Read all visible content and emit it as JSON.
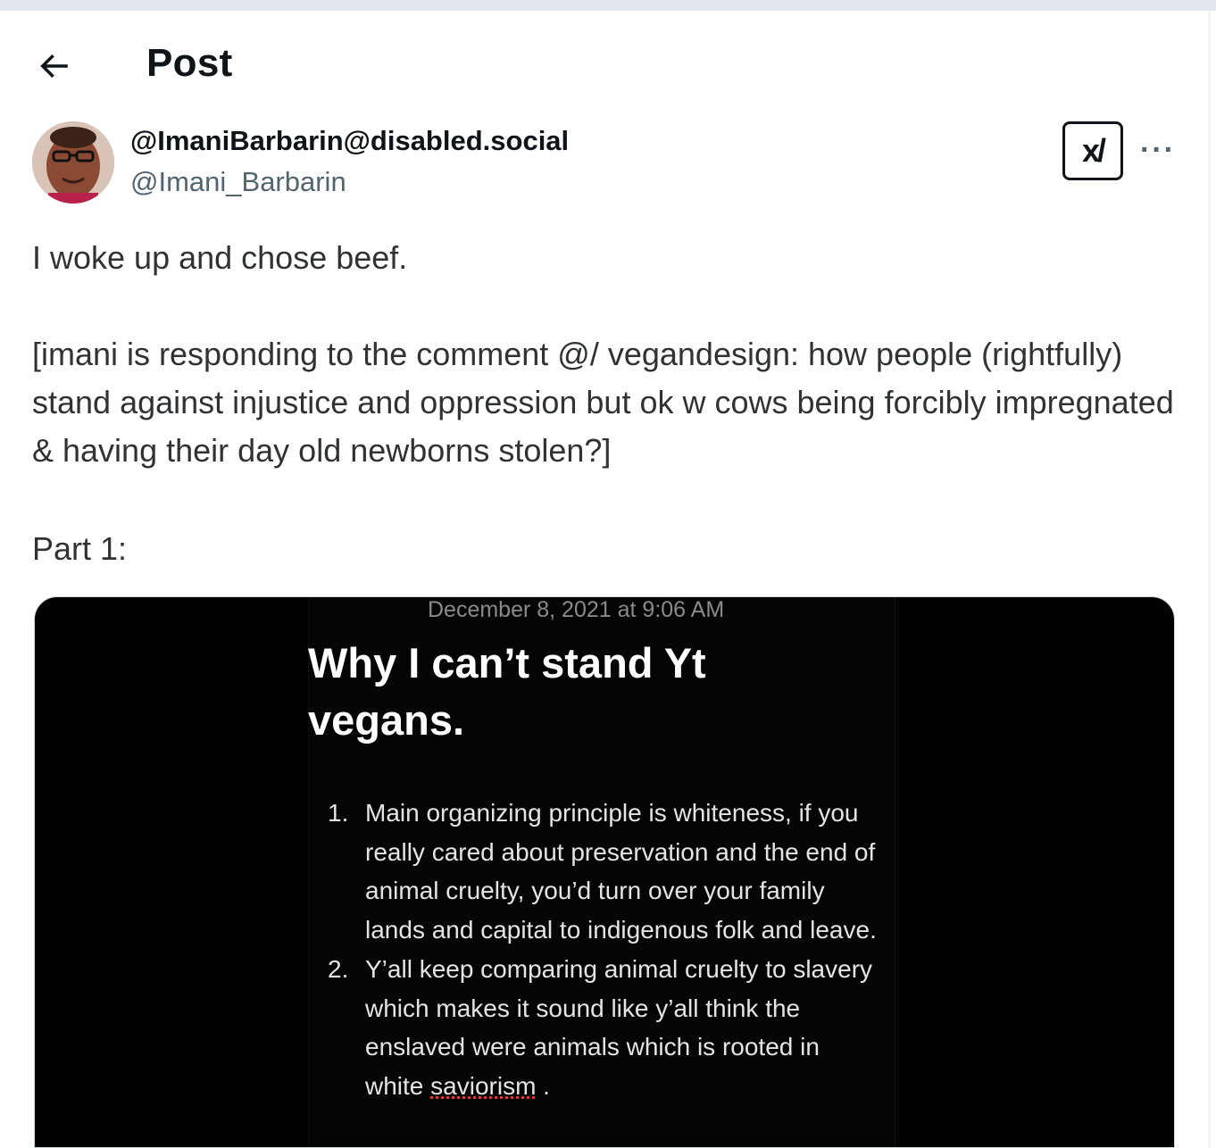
{
  "header": {
    "back_label": "Back",
    "title": "Post"
  },
  "author": {
    "display_name": "@ImaniBarbarin@disabled.social",
    "handle": "@Imani_Barbarin",
    "grok_label": "x/"
  },
  "post": {
    "line1": "I woke up and chose beef.",
    "line2": "[imani is responding to the comment @/ vegandesign:   how people (rightfully) stand against injustice and oppression but ok w cows being forcibly impregnated & having their day old newborns stolen?]",
    "line3": "Part 1:"
  },
  "media": {
    "date": "December 8, 2021 at 9:06 AM",
    "heading": "Why I can’t stand Yt vegans.",
    "items": [
      {
        "num": "1.",
        "text": "Main organizing principle is whiteness, if you really cared about preservation and the end of animal cruelty, you’d turn over your family lands and capital to indigenous folk and leave."
      },
      {
        "num": "2.",
        "text_before": "Y’all keep comparing animal cruelty to slavery which makes it sound like y’all think the enslaved were animals which is rooted in white ",
        "text_underlined": "saviorism",
        "text_after": " ."
      }
    ]
  },
  "colors": {
    "text_primary": "#0f1419",
    "text_secondary": "#536471",
    "media_background": "#000000",
    "top_strip": "#e3e8ee"
  },
  "icons": {
    "back": "arrow-left-icon",
    "more": "more-horizontal-icon",
    "grok": "grok-icon"
  }
}
